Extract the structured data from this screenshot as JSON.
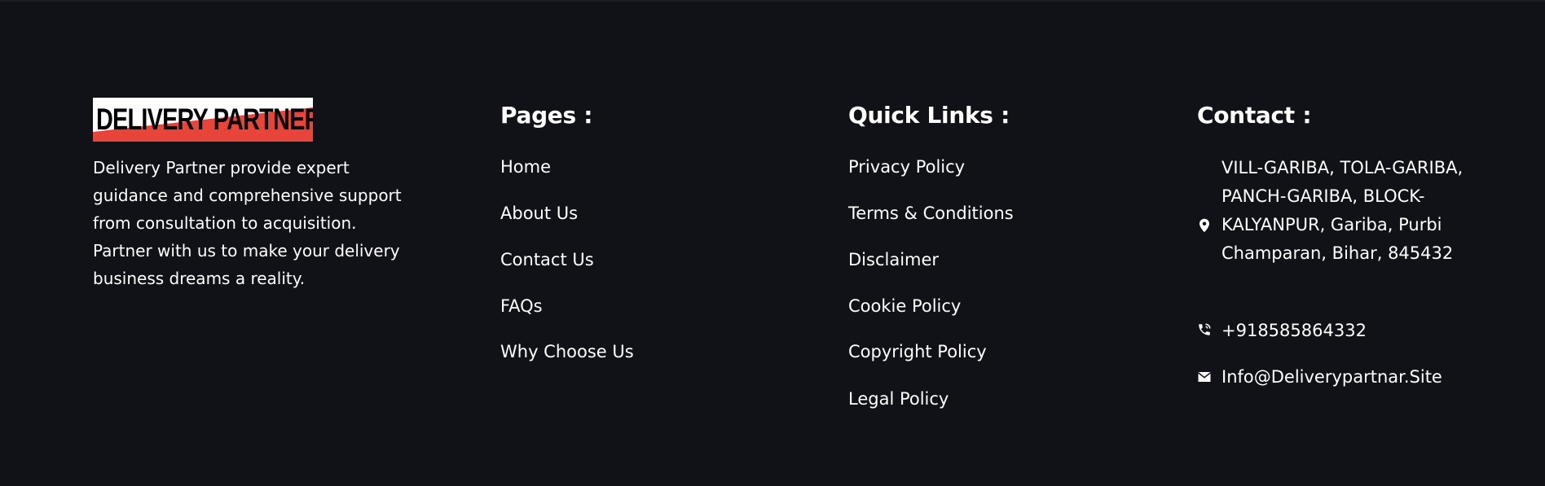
{
  "brand": {
    "logo_text": "DELIVERY PARTNER",
    "logo_colors": {
      "top": "#ffffff",
      "bottom": "#e8443a"
    },
    "description": "Delivery Partner provide expert guidance and comprehensive support from consultation to acquisition. Partner with us to make your delivery business dreams a reality."
  },
  "pages": {
    "title": "Pages :",
    "items": [
      "Home",
      "About Us",
      "Contact Us",
      "FAQs",
      "Why Choose Us"
    ]
  },
  "quick_links": {
    "title": "Quick Links :",
    "items": [
      "Privacy Policy",
      "Terms & Conditions",
      "Disclaimer",
      "Cookie Policy",
      "Copyright Policy",
      "Legal Policy"
    ]
  },
  "contact": {
    "title": "Contact :",
    "address": "VILL-GARIBA, TOLA-GARIBA, PANCH-GARIBA, BLOCK-KALYANPUR, Gariba, Purbi Champaran, Bihar, 845432",
    "phone": "+918585864332",
    "email": "Info@Deliverypartnar.Site",
    "icons": [
      "map-pin-icon",
      "phone-icon",
      "mail-icon"
    ]
  },
  "colors": {
    "background": "#111217",
    "text": "#ffffff"
  }
}
